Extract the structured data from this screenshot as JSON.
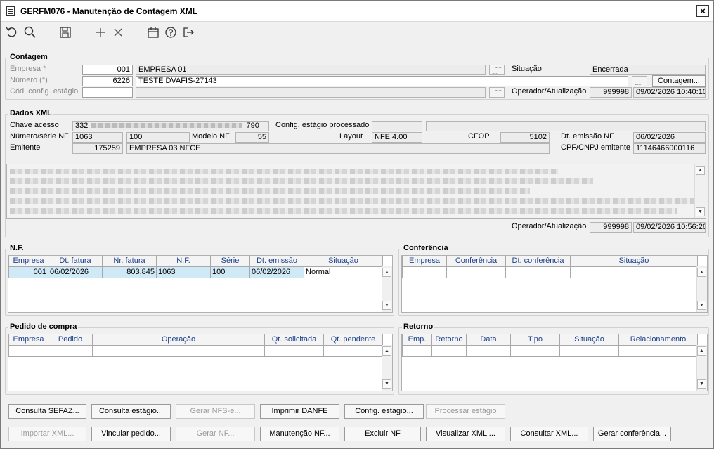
{
  "window": {
    "title": "GERFM076 - Manutenção de Contagem XML",
    "close_label": "×"
  },
  "toolbar": {
    "icons": [
      "undo-icon",
      "search-icon",
      "save-icon",
      "add-icon",
      "delete-icon",
      "calendar-icon",
      "help-icon",
      "exit-icon"
    ]
  },
  "contagem": {
    "title": "Contagem",
    "empresa_label": "Empresa *",
    "empresa_code": "001",
    "empresa_name": "EMPRESA 01",
    "numero_label": "Número (*)",
    "numero_value": "6226",
    "numero_desc": "TESTE DVAFIS-27143",
    "config_label": "Cód. config. estágio",
    "config_value": "",
    "config_desc": "",
    "situacao_label": "Situação",
    "situacao_value": "Encerrada",
    "contagem_button": "Contagem...",
    "operador_label": "Operador/Atualização",
    "operador_value": "999998",
    "operador_date": "09/02/2026 10:40:10"
  },
  "dados_xml": {
    "title": "Dados XML",
    "chave_label": "Chave acesso",
    "chave_prefix": "332",
    "chave_suffix": "790",
    "config_proc_label": "Config. estágio processado",
    "config_proc_value": "",
    "config_proc_desc": "",
    "numero_serie_label": "Número/série NF",
    "numero_nf": "1063",
    "serie_nf": "100",
    "modelo_label": "Modelo NF",
    "modelo_value": "55",
    "layout_label": "Layout",
    "layout_value": "NFE 4.00",
    "cfop_label": "CFOP",
    "cfop_value": "5102",
    "dt_emissao_label": "Dt. emissão NF",
    "dt_emissao_value": "06/02/2026",
    "emitente_label": "Emitente",
    "emitente_code": "175259",
    "emitente_name": "EMPRESA 03 NFCE",
    "cnpj_label": "CPF/CNPJ emitente",
    "cnpj_value": "11146466000116",
    "operador_label": "Operador/Atualização",
    "operador_value": "999998",
    "operador_date": "09/02/2026 10:56:26"
  },
  "nf": {
    "title": "N.F.",
    "columns": [
      "Empresa",
      "Dt. fatura",
      "Nr. fatura",
      "N.F.",
      "Série",
      "Dt. emissão",
      "Situação"
    ],
    "rows": [
      [
        "001",
        "06/02/2026",
        "803.845",
        "1063",
        "100",
        "06/02/2026",
        "Normal"
      ]
    ]
  },
  "conferencia": {
    "title": "Conferência",
    "columns": [
      "Empresa",
      "Conferência",
      "Dt. conferência",
      "Situação"
    ]
  },
  "pedido": {
    "title": "Pedido de compra",
    "columns": [
      "Empresa",
      "Pedido",
      "Operação",
      "Qt. solicitada",
      "Qt. pendente"
    ]
  },
  "retorno": {
    "title": "Retorno",
    "columns": [
      "Emp.",
      "Retorno",
      "Data",
      "Tipo",
      "Situação",
      "Relacionamento"
    ]
  },
  "buttons": {
    "consulta_sefaz": "Consulta SEFAZ...",
    "consulta_estagio": "Consulta estágio...",
    "gerar_nfse": "Gerar NFS-e...",
    "imprimir_danfe": "Imprimir DANFE",
    "config_estagio": "Config. estágio...",
    "processar_estagio": "Processar estágio",
    "importar_xml": "Importar XML...",
    "vincular_pedido": "Vincular pedido...",
    "gerar_nf": "Gerar NF...",
    "manutencao_nf": "Manutenção NF...",
    "excluir_nf": "Excluir NF",
    "visualizar_xml": "Visualizar XML ...",
    "consultar_xml": "Consultar XML...",
    "gerar_conferencia": "Gerar conferência..."
  }
}
